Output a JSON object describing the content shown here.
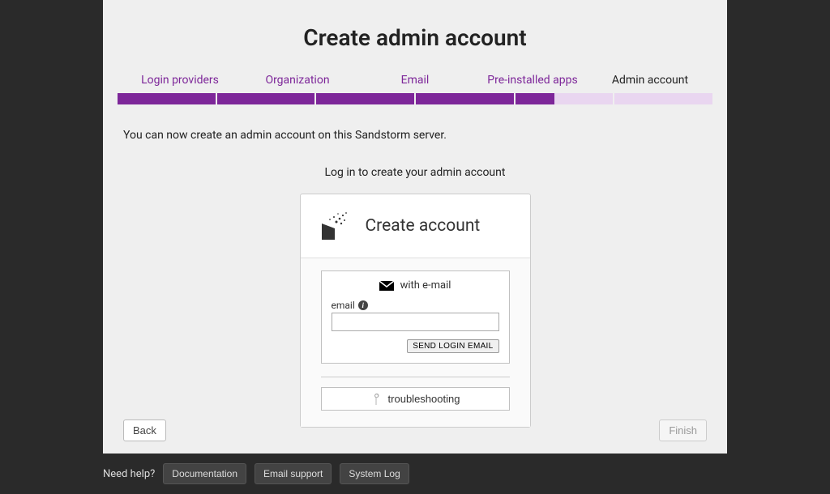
{
  "page_title": "Create admin account",
  "wizard_steps": [
    "Login providers",
    "Organization",
    "Email",
    "Pre-installed apps",
    "Admin account"
  ],
  "description": "You can now create an admin account on this Sandstorm server.",
  "login_prompt": "Log in to create your admin account",
  "card": {
    "title": "Create account",
    "with_email": "with e-mail",
    "email_label": "email",
    "send_button": "SEND LOGIN EMAIL",
    "troubleshooting": "troubleshooting"
  },
  "nav": {
    "back": "Back",
    "finish": "Finish"
  },
  "help": {
    "label": "Need help?",
    "docs": "Documentation",
    "email": "Email support",
    "log": "System Log"
  }
}
